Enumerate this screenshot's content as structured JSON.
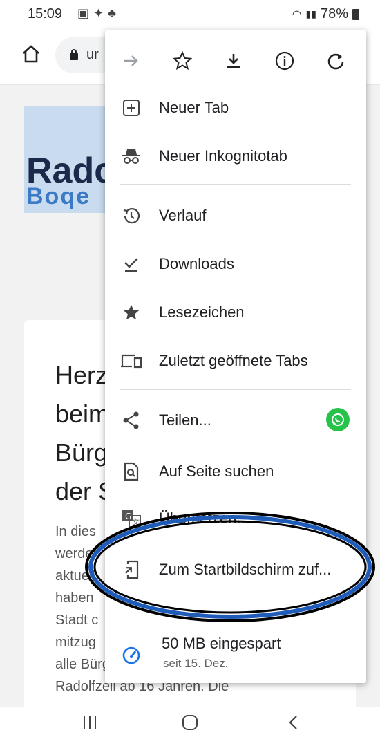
{
  "status_bar": {
    "time": "15:09",
    "notif_icons": [
      "gallery-icon",
      "twitter-icon",
      "activity-icon"
    ],
    "battery": "78%"
  },
  "toolbar": {
    "url_text": "ur"
  },
  "page": {
    "logo_text": "Radc",
    "logo_sub": "Boqe",
    "headline_lines": [
      "Herz",
      "beim",
      "Bürg",
      "der S"
    ],
    "para_lines": [
      "In dies",
      "werder",
      "aktuell",
      "haben",
      "Stadt c",
      "mitzug",
      "alle Bürgerinnen und Bürger von",
      "Radolfzell ab 16 Jahren. Die"
    ]
  },
  "menu": {
    "top_actions": [
      "forward-icon",
      "bookmark-star-icon",
      "download-icon",
      "info-icon",
      "reload-icon"
    ],
    "items": [
      {
        "label": "Neuer Tab",
        "icon": "new-tab-icon"
      },
      {
        "label": "Neuer Inkognitotab",
        "icon": "incognito-icon"
      },
      {
        "label": "Verlauf",
        "icon": "history-icon"
      },
      {
        "label": "Downloads",
        "icon": "downloads-icon"
      },
      {
        "label": "Lesezeichen",
        "icon": "bookmarks-star-icon"
      },
      {
        "label": "Zuletzt geöffnete Tabs",
        "icon": "recent-tabs-icon"
      },
      {
        "label": "Teilen...",
        "icon": "share-icon"
      },
      {
        "label": "Auf Seite suchen",
        "icon": "find-in-page-icon"
      },
      {
        "label": "Übersetzen...",
        "icon": "translate-icon"
      },
      {
        "label": "Zum Startbildschirm zuf...",
        "icon": "add-to-home-icon"
      }
    ],
    "savings": {
      "label": "50 MB eingespart",
      "sub": "seit 15. Dez."
    }
  },
  "colors": {
    "accent_blue": "#1a73e8",
    "whatsapp_green": "#27c24a",
    "annotation_blue": "#1f5bb8"
  }
}
